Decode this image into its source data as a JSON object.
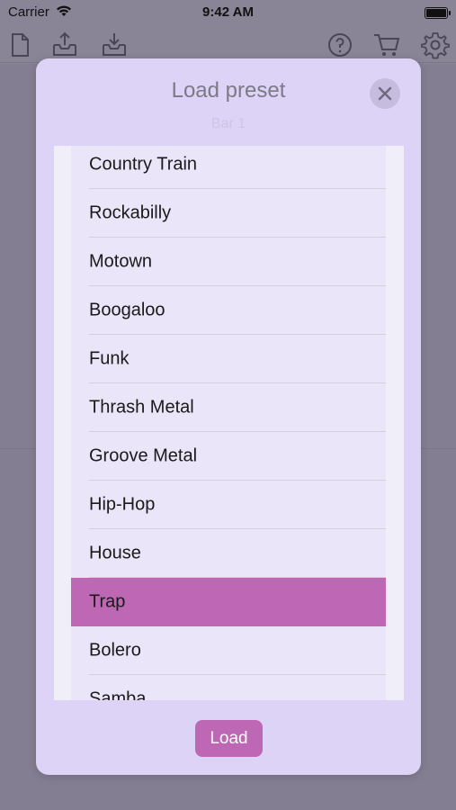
{
  "status_bar": {
    "carrier": "Carrier",
    "time": "9:42 AM"
  },
  "toolbar": {
    "icons": [
      "new-document-icon",
      "export-icon",
      "import-icon",
      "help-icon",
      "cart-icon",
      "settings-icon"
    ]
  },
  "modal": {
    "title": "Load preset",
    "subtitle": "Bar 1",
    "close_icon": "close-icon",
    "items": [
      {
        "label": "Country Train",
        "selected": false
      },
      {
        "label": "Rockabilly",
        "selected": false
      },
      {
        "label": "Motown",
        "selected": false
      },
      {
        "label": "Boogaloo",
        "selected": false
      },
      {
        "label": "Funk",
        "selected": false
      },
      {
        "label": "Thrash Metal",
        "selected": false
      },
      {
        "label": "Groove Metal",
        "selected": false
      },
      {
        "label": "Hip-Hop",
        "selected": false
      },
      {
        "label": "House",
        "selected": false
      },
      {
        "label": "Trap",
        "selected": true
      },
      {
        "label": "Bolero",
        "selected": false
      },
      {
        "label": "Samba",
        "selected": false
      }
    ],
    "load_label": "Load"
  },
  "colors": {
    "accent": "#be67b4",
    "modal_bg": "#dcd3f6",
    "overlay": "#8a8497"
  }
}
